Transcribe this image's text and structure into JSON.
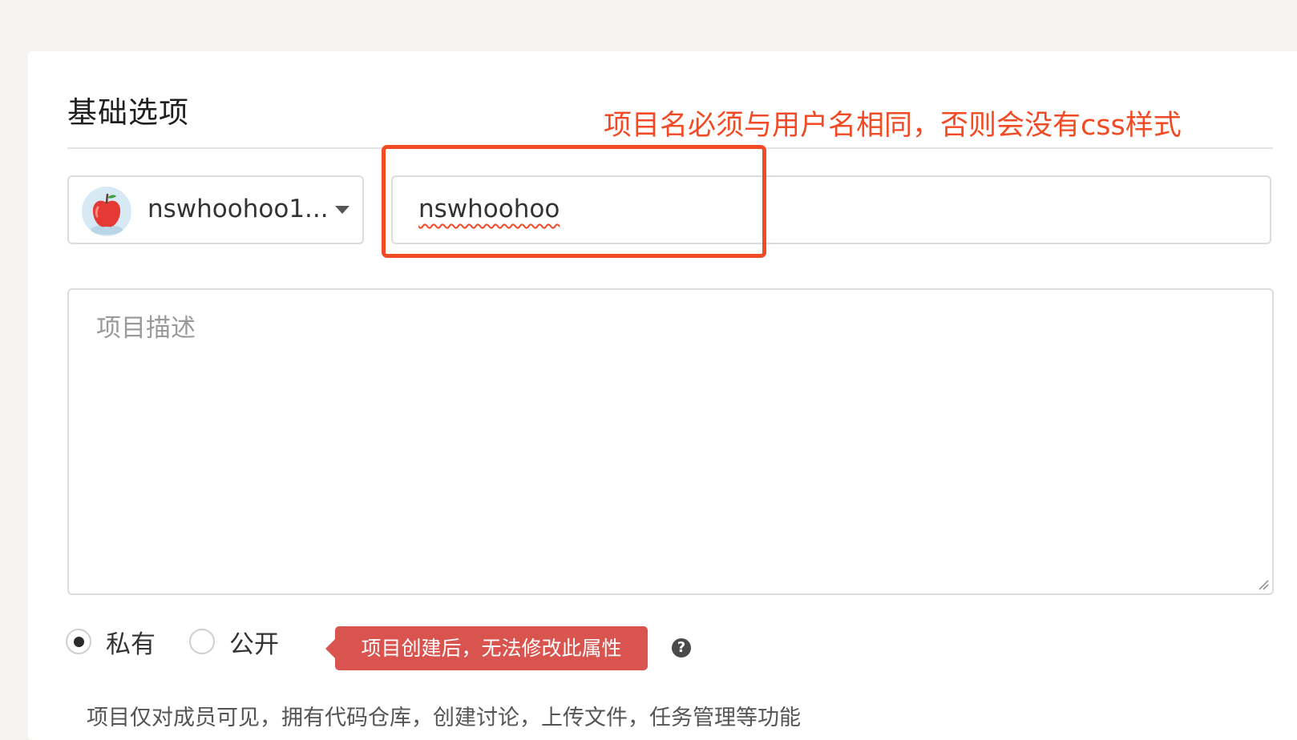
{
  "section": {
    "title": "基础选项"
  },
  "annotation": {
    "text": "项目名必须与用户名相同，否则会没有css样式",
    "color": "#f24a24"
  },
  "owner_select": {
    "value": "nswhoohoo1...",
    "avatar_icon": "apple-avatar-icon"
  },
  "project_name": {
    "value": "nswhoohoo"
  },
  "description": {
    "placeholder": "项目描述"
  },
  "visibility": {
    "options": [
      {
        "label": "私有",
        "selected": true
      },
      {
        "label": "公开",
        "selected": false
      }
    ],
    "tooltip": "项目创建后，无法修改此属性",
    "help_icon": "question-circle-icon",
    "description": "项目仅对成员可见，拥有代码仓库，创建讨论，上传文件，任务管理等功能"
  },
  "colors": {
    "accent_red": "#f24a24",
    "tooltip_bg": "#d9534f",
    "page_bg": "#f5f4f1"
  }
}
